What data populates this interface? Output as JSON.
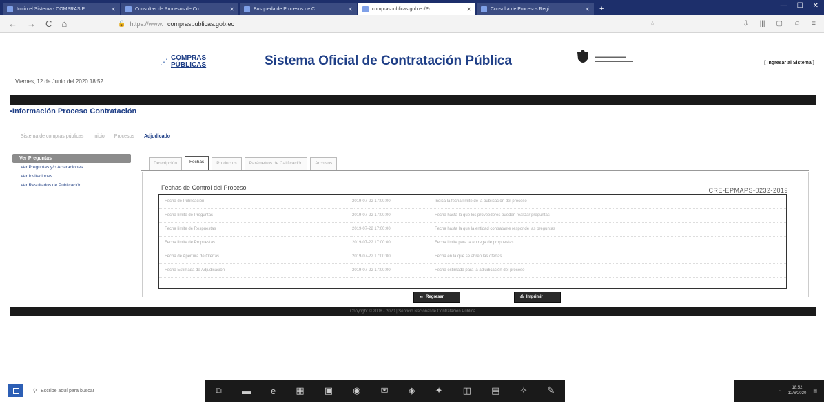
{
  "browser": {
    "tabs": [
      {
        "label": "Inicio el Sistema - COMPRAS P...",
        "active": false
      },
      {
        "label": "Consultas de Procesos de Co...",
        "active": false
      },
      {
        "label": "Busqueda de Procesos de C...",
        "active": false
      },
      {
        "label": "compraspublicas.gob.ec/Pr...",
        "active": true
      },
      {
        "label": "Consulta de Procesos Regi...",
        "active": false
      }
    ],
    "new_tab": "+",
    "url_host": "compraspublicas.gob.ec",
    "url_prefix": "https://www.",
    "nav_back": "←",
    "nav_forward": "→",
    "nav_reload": "C",
    "nav_home": "⌂"
  },
  "header": {
    "logo_text_1": "COMPRAS",
    "logo_text_2": "PÚBLICAS",
    "title": "Sistema Oficial de Contratación Pública",
    "date_text": "Viernes, 12 de Junio del 2020 18:52",
    "login_link": "[ Ingresar al Sistema ]"
  },
  "page": {
    "heading": "Información Proceso Contratación",
    "breadcrumb": [
      {
        "label": "Sistema de compras públicas",
        "current": false
      },
      {
        "label": "Inicio",
        "current": false
      },
      {
        "label": "Procesos",
        "current": false
      },
      {
        "label": "Adjudicado",
        "current": true
      }
    ]
  },
  "left_menu": {
    "header": "Ver Preguntas",
    "items": [
      "Ver Preguntas y/o Aclaraciones",
      "Ver Invitaciones",
      "Ver Resultados de Publicación"
    ]
  },
  "process_tabs": [
    {
      "label": "Descripción",
      "active": false
    },
    {
      "label": "Fechas",
      "active": true
    },
    {
      "label": "Productos",
      "active": false
    },
    {
      "label": "Parámetros de Calificación",
      "active": false
    },
    {
      "label": "Archivos",
      "active": false
    }
  ],
  "dates_section": {
    "title": "Fechas de Control del Proceso",
    "process_code": "CRE-EPMAPS-0232-2019",
    "rows": [
      {
        "label": "Fecha de Publicación",
        "date": "2019-07-22 17:00:00",
        "desc": "Indica la fecha límite de la publicación del proceso"
      },
      {
        "label": "Fecha límite de Preguntas",
        "date": "2019-07-22 17:00:00",
        "desc": "Fecha hasta la que los proveedores pueden realizar preguntas"
      },
      {
        "label": "Fecha límite de Respuestas",
        "date": "2019-07-22 17:00:00",
        "desc": "Fecha hasta la que la entidad contratante responde las preguntas"
      },
      {
        "label": "Fecha límite de Propuestas",
        "date": "2019-07-22 17:00:00",
        "desc": "Fecha límite para la entrega de propuestas"
      },
      {
        "label": "Fecha de Apertura de Ofertas",
        "date": "2019-07-22 17:00:00",
        "desc": "Fecha en la que se abren las ofertas"
      },
      {
        "label": "Fecha Estimada de Adjudicación",
        "date": "2019-07-22 17:00:00",
        "desc": "Fecha estimada para la adjudicación del proceso"
      }
    ]
  },
  "buttons": {
    "back": "Regresar",
    "print": "Imprimir"
  },
  "footer": {
    "text": "Copyright © 2008 - 2020 | Servicio Nacional de Contratación Pública"
  },
  "taskbar": {
    "search_placeholder": "Escribe aquí para buscar",
    "time": "18:52",
    "date": "12/6/2020"
  }
}
